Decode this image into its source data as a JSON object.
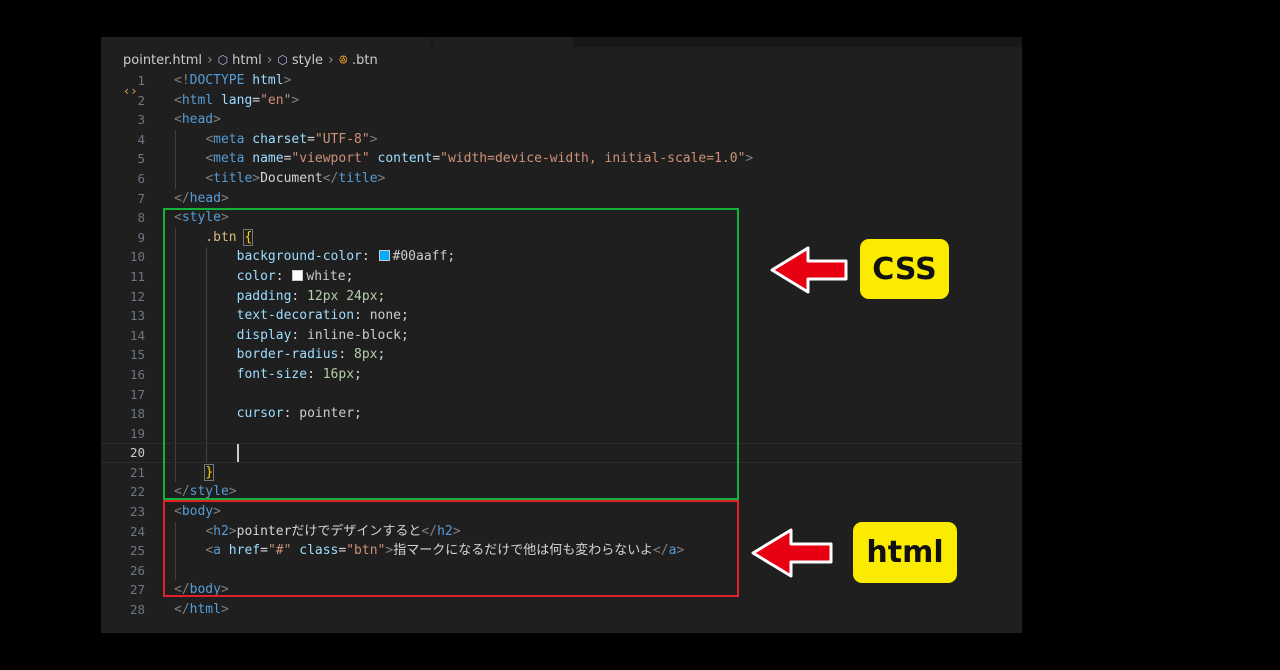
{
  "breadcrumb": {
    "items": [
      {
        "label": "pointer.html",
        "icon": "code-file-icon",
        "glyph": "‹›"
      },
      {
        "label": "html",
        "icon": "cube-icon",
        "glyph": "⬡"
      },
      {
        "label": "style",
        "icon": "cube-icon",
        "glyph": "⬡"
      },
      {
        "label": ".btn",
        "icon": "css-class-icon",
        "glyph": "ꔮ"
      }
    ],
    "separator": "›"
  },
  "editor": {
    "active_line": 20,
    "lines": [
      {
        "n": "1",
        "html": "<span class=\"tg\">&lt;!</span><span class=\"tn\">DOCTYPE</span> <span class=\"an\">html</span><span class=\"tg\">&gt;</span>"
      },
      {
        "n": "2",
        "html": "<span class=\"tg\">&lt;</span><span class=\"tn\">html</span> <span class=\"an\">lang</span><span class=\"tx\">=</span><span class=\"av\">\"en\"</span><span class=\"tg\">&gt;</span>"
      },
      {
        "n": "3",
        "html": "<span class=\"tg\">&lt;</span><span class=\"tn\">head</span><span class=\"tg\">&gt;</span>"
      },
      {
        "n": "4",
        "html": "    <span class=\"tg\">&lt;</span><span class=\"tn\">meta</span> <span class=\"an\">charset</span><span class=\"tx\">=</span><span class=\"av\">\"UTF-8\"</span><span class=\"tg\">&gt;</span>"
      },
      {
        "n": "5",
        "html": "    <span class=\"tg\">&lt;</span><span class=\"tn\">meta</span> <span class=\"an\">name</span><span class=\"tx\">=</span><span class=\"av\">\"viewport\"</span> <span class=\"an\">content</span><span class=\"tx\">=</span><span class=\"av\">\"width=device-width, initial-scale=1.0\"</span><span class=\"tg\">&gt;</span>"
      },
      {
        "n": "6",
        "html": "    <span class=\"tg\">&lt;</span><span class=\"tn\">title</span><span class=\"tg\">&gt;</span><span class=\"tx\">Document</span><span class=\"tg\">&lt;/</span><span class=\"tn\">title</span><span class=\"tg\">&gt;</span>"
      },
      {
        "n": "7",
        "html": "<span class=\"tg\">&lt;/</span><span class=\"tn\">head</span><span class=\"tg\">&gt;</span>"
      },
      {
        "n": "8",
        "html": "<span class=\"tg\">&lt;</span><span class=\"tn\">style</span><span class=\"tg\">&gt;</span>"
      },
      {
        "n": "9",
        "html": "    <span class=\"sel\">.btn</span> <span class=\"br brbox\">{</span>"
      },
      {
        "n": "10",
        "html": "        <span class=\"pp\">background-color</span><span class=\"tx\">: </span><span class=\"swatch\" style=\"background:#00aaff\"></span><span class=\"pv\">#00aaff</span><span class=\"tx\">;</span>"
      },
      {
        "n": "11",
        "html": "        <span class=\"pp\">color</span><span class=\"tx\">: </span><span class=\"swatch\" style=\"background:#ffffff\"></span><span class=\"pv\">white</span><span class=\"tx\">;</span>"
      },
      {
        "n": "12",
        "html": "        <span class=\"pp\">padding</span><span class=\"tx\">: </span><span class=\"num\">12px 24px</span><span class=\"tx\">;</span>"
      },
      {
        "n": "13",
        "html": "        <span class=\"pp\">text-decoration</span><span class=\"tx\">: </span><span class=\"pv\">none</span><span class=\"tx\">;</span>"
      },
      {
        "n": "14",
        "html": "        <span class=\"pp\">display</span><span class=\"tx\">: </span><span class=\"pv\">inline-block</span><span class=\"tx\">;</span>"
      },
      {
        "n": "15",
        "html": "        <span class=\"pp\">border-radius</span><span class=\"tx\">: </span><span class=\"num\">8px</span><span class=\"tx\">;</span>"
      },
      {
        "n": "16",
        "html": "        <span class=\"pp\">font-size</span><span class=\"tx\">: </span><span class=\"num\">16px</span><span class=\"tx\">;</span>"
      },
      {
        "n": "17",
        "html": ""
      },
      {
        "n": "18",
        "html": "        <span class=\"pp\">cursor</span><span class=\"tx\">: </span><span class=\"pv\">pointer</span><span class=\"tx\">;</span>"
      },
      {
        "n": "19",
        "html": ""
      },
      {
        "n": "20",
        "html": ""
      },
      {
        "n": "21",
        "html": "    <span class=\"br brbox\">}</span>"
      },
      {
        "n": "22",
        "html": "<span class=\"tg\">&lt;/</span><span class=\"tn\">style</span><span class=\"tg\">&gt;</span>"
      },
      {
        "n": "23",
        "html": "<span class=\"tg\">&lt;</span><span class=\"tn\">body</span><span class=\"tg\">&gt;</span>"
      },
      {
        "n": "24",
        "html": "    <span class=\"tg\">&lt;</span><span class=\"tn\">h2</span><span class=\"tg\">&gt;</span><span class=\"tx\">pointerだけでデザインすると</span><span class=\"tg\">&lt;/</span><span class=\"tn\">h2</span><span class=\"tg\">&gt;</span>"
      },
      {
        "n": "25",
        "html": "    <span class=\"tg\">&lt;</span><span class=\"tn\">a</span> <span class=\"an\">href</span><span class=\"tx\">=</span><span class=\"av\">\"#\"</span> <span class=\"an\">class</span><span class=\"tx\">=</span><span class=\"av\">\"btn\"</span><span class=\"tg\">&gt;</span><span class=\"tx\">指マークになるだけで他は何も変わらないよ</span><span class=\"tg\">&lt;/</span><span class=\"tn\">a</span><span class=\"tg\">&gt;</span>"
      },
      {
        "n": "26",
        "html": ""
      },
      {
        "n": "27",
        "html": "<span class=\"tg\">&lt;/</span><span class=\"tn\">body</span><span class=\"tg\">&gt;</span>"
      },
      {
        "n": "28",
        "html": "<span class=\"tg\">&lt;/</span><span class=\"tn\">html</span><span class=\"tg\">&gt;</span>"
      }
    ]
  },
  "annotations": {
    "css_label": "CSS",
    "html_label": "html",
    "colors": {
      "green_box": "#13b23a",
      "red_box": "#e0202a",
      "arrow": "#e60012",
      "label_bg": "#fbeb00"
    }
  }
}
